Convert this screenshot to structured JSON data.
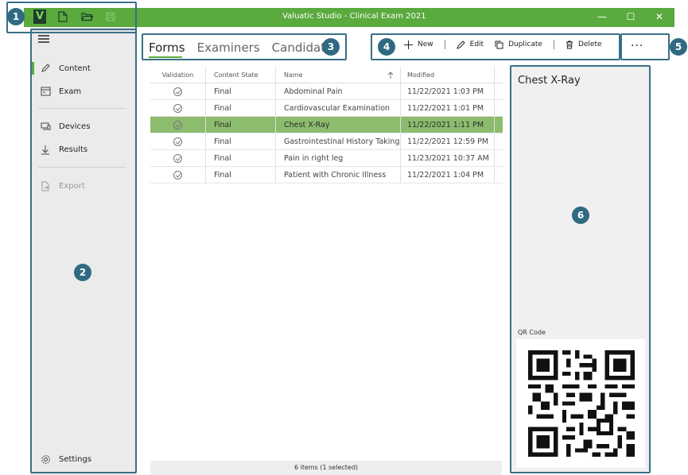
{
  "window": {
    "title": "Valuatic Studio - Clinical Exam 2021",
    "controls": {
      "minimize": "—",
      "maximize": "☐",
      "close": "✕"
    },
    "accent": "#5aaa3e"
  },
  "titlebar_icons": [
    "app-logo",
    "new-file-icon",
    "open-folder-icon",
    "save-icon"
  ],
  "app_logo_letter": "V",
  "sidebar": {
    "items": [
      {
        "label": "Content",
        "icon": "pencil-icon",
        "active": true
      },
      {
        "label": "Exam",
        "icon": "exam-icon"
      },
      {
        "label": "Devices",
        "icon": "devices-icon"
      },
      {
        "label": "Results",
        "icon": "download-icon"
      },
      {
        "label": "Export",
        "icon": "export-icon",
        "disabled": true
      }
    ],
    "settings_label": "Settings"
  },
  "tabs": [
    {
      "label": "Forms",
      "active": true
    },
    {
      "label": "Examiners"
    },
    {
      "label": "Candidates"
    }
  ],
  "commands": {
    "new": "New",
    "edit": "Edit",
    "duplicate": "Duplicate",
    "delete": "Delete",
    "more": "···"
  },
  "table": {
    "columns": [
      "Validation",
      "Content State",
      "Name",
      "Modified"
    ],
    "rows": [
      {
        "state": "Final",
        "name": "Abdominal Pain",
        "modified": "11/22/2021 1:03 PM"
      },
      {
        "state": "Final",
        "name": "Cardiovascular Examination",
        "modified": "11/22/2021 1:01 PM"
      },
      {
        "state": "Final",
        "name": "Chest X-Ray",
        "modified": "11/22/2021 1:11 PM",
        "selected": true
      },
      {
        "state": "Final",
        "name": "Gastrointestinal History Taking",
        "modified": "11/22/2021 12:59 PM"
      },
      {
        "state": "Final",
        "name": "Pain in right leg",
        "modified": "11/23/2021 10:37 AM"
      },
      {
        "state": "Final",
        "name": "Patient with Chronic Illness",
        "modified": "11/22/2021 1:04 PM"
      }
    ],
    "status": "6 items (1 selected)"
  },
  "detail": {
    "title": "Chest X-Ray",
    "qr_label": "QR Code"
  },
  "callouts": [
    "1",
    "2",
    "3",
    "4",
    "5",
    "6"
  ]
}
